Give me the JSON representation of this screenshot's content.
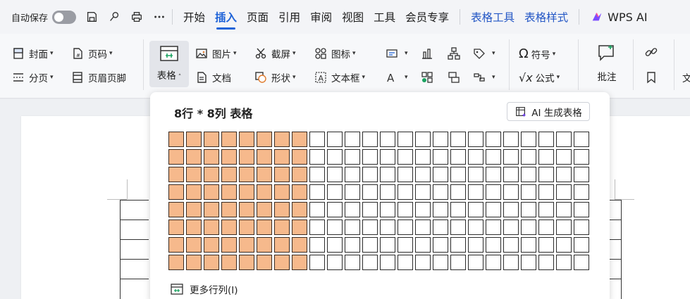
{
  "menubar": {
    "autosave_label": "自动保存",
    "tabs": [
      "开始",
      "插入",
      "页面",
      "引用",
      "审阅",
      "视图",
      "工具",
      "会员专享"
    ],
    "active_tab": "插入",
    "context_tabs": [
      "表格工具",
      "表格样式"
    ],
    "wps_ai": "WPS AI",
    "quick_icons": [
      "save-icon",
      "brush-icon",
      "print-icon",
      "more-icon"
    ]
  },
  "ribbon": {
    "cover": "封面",
    "page_num": "页码",
    "section": "分页",
    "header_footer": "页眉页脚",
    "table": "表格",
    "picture": "图片",
    "screenshot": "截屏",
    "icon": "图标",
    "document": "文档",
    "shape": "形状",
    "textbox": "文本框",
    "symbol": "符号",
    "formula": "公式",
    "comment": "批注",
    "cut_label": "文"
  },
  "dropdown": {
    "title": "8行 * 8列 表格",
    "ai_button": "AI 生成表格",
    "more_label": "更多行列(I)",
    "grid_rows": 8,
    "grid_cols": 24,
    "selected_rows": 8,
    "selected_cols": 8
  },
  "colors": {
    "accent": "#1f63d8",
    "selected_cell": "#f6b98c",
    "context_tab": "#2457c5"
  }
}
